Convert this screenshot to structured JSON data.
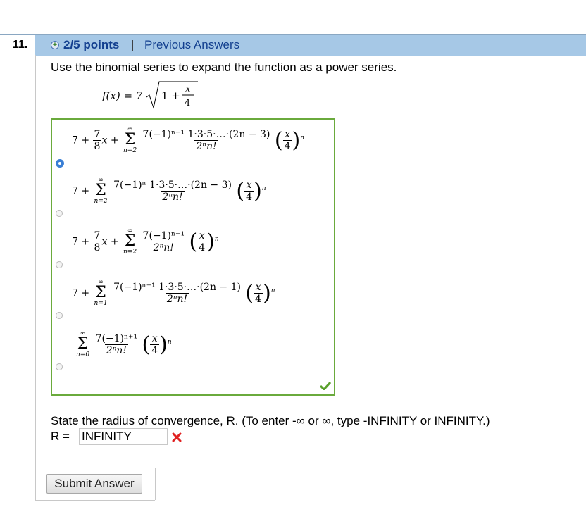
{
  "header": {
    "question_number": "11.",
    "points": "2/5 points",
    "separator": "|",
    "previous_answers": "Previous Answers"
  },
  "question": {
    "prompt": "Use the binomial series to expand the function as a power series.",
    "function_lhs": "f(x) = 7",
    "function_radicand_lead": "1 +",
    "function_frac_num": "x",
    "function_frac_den": "4"
  },
  "choices": [
    {
      "selected": true,
      "lead": "7 +",
      "coef_num": "7",
      "coef_den": "8",
      "coef_tail": "x +",
      "sum_top": "∞",
      "sum_bot": "n=2",
      "num": "7(−1)ⁿ⁻¹ 1·3·5·…·(2n − 3)",
      "den": "2ⁿn!",
      "power": "n"
    },
    {
      "selected": false,
      "lead": "7 +",
      "sum_top": "∞",
      "sum_bot": "n=2",
      "num": "7(−1)ⁿ 1·3·5·…·(2n − 3)",
      "den": "2ⁿn!",
      "power": "n"
    },
    {
      "selected": false,
      "lead": "7 +",
      "coef_num": "7",
      "coef_den": "8",
      "coef_tail": "x +",
      "sum_top": "∞",
      "sum_bot": "n=2",
      "num": "7(−1)ⁿ⁻¹",
      "den": "2ⁿn!",
      "power": "n"
    },
    {
      "selected": false,
      "lead": "7 +",
      "sum_top": "∞",
      "sum_bot": "n=1",
      "num": "7(−1)ⁿ⁻¹ 1·3·5·…·(2n − 1)",
      "den": "2ⁿn!",
      "power": "n"
    },
    {
      "selected": false,
      "sum_top": "∞",
      "sum_bot": "n=0",
      "num": "7(−1)ⁿ⁺¹",
      "den": "2ⁿn!",
      "power": "n"
    }
  ],
  "xfrac": {
    "num": "x",
    "den": "4"
  },
  "radius": {
    "instruction": "State the radius of convergence, R. (To enter -∞ or ∞, type -INFINITY or INFINITY.)",
    "label": "R =",
    "value": "INFINITY",
    "status": "incorrect"
  },
  "submit_label": "Submit Answer",
  "colors": {
    "header_bg": "#a6c8e6",
    "link": "#123f8f",
    "correct_border": "#6aaa3c",
    "incorrect": "#e02020"
  }
}
